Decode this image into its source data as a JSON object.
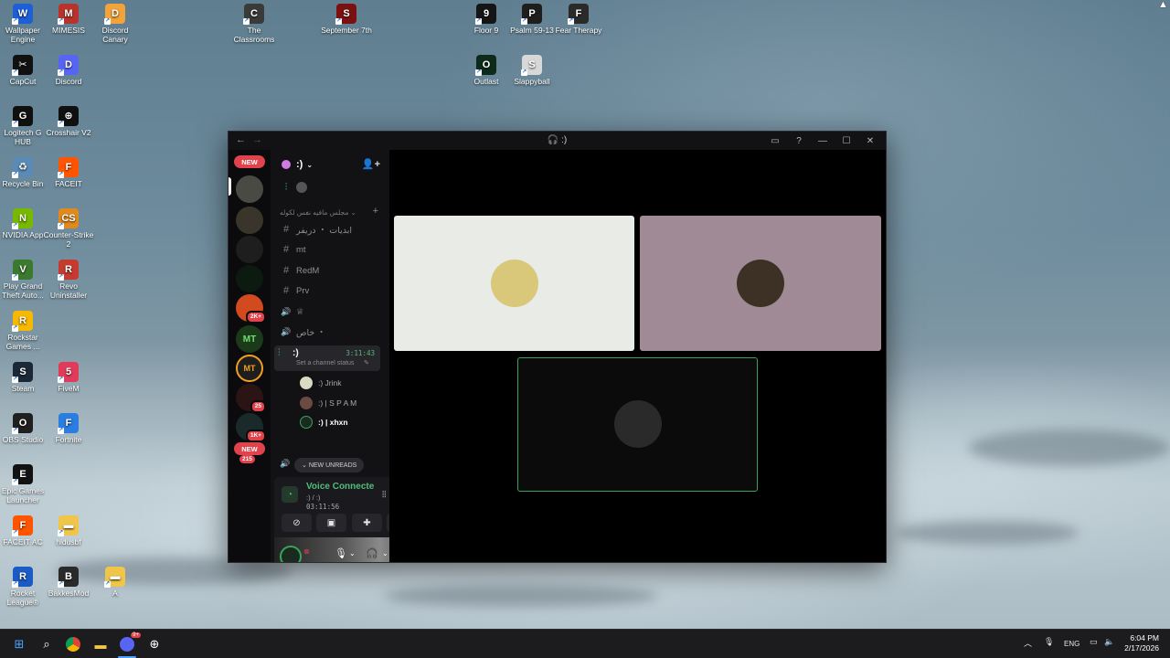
{
  "desktop": {
    "icons": [
      {
        "label": "Wallpaper Engine",
        "color": "#1d5fd6",
        "glyph": "W"
      },
      {
        "label": "MIMESIS",
        "color": "#b8332b",
        "glyph": "M"
      },
      {
        "label": "Discord Canary",
        "color": "#f2a33a",
        "glyph": "D"
      },
      {
        "label": "CapCut",
        "color": "#111111",
        "glyph": "✂"
      },
      {
        "label": "Discord",
        "color": "#5865f2",
        "glyph": "D"
      },
      {
        "label": "Logitech G HUB",
        "color": "#101010",
        "glyph": "G"
      },
      {
        "label": "Crosshair V2",
        "color": "#101010",
        "glyph": "⊕"
      },
      {
        "label": "Recycle Bin",
        "color": "#5a8ab5",
        "glyph": "♻"
      },
      {
        "label": "FACEIT",
        "color": "#ff5500",
        "glyph": "F"
      },
      {
        "label": "NVIDIA App",
        "color": "#76b900",
        "glyph": "N"
      },
      {
        "label": "Counter-Strike 2",
        "color": "#e08a1e",
        "glyph": "CS"
      },
      {
        "label": "Play Grand Theft Auto...",
        "color": "#3b7a2e",
        "glyph": "V"
      },
      {
        "label": "Revo Uninstaller",
        "color": "#c63b2f",
        "glyph": "R"
      },
      {
        "label": "Rockstar Games ...",
        "color": "#f6b800",
        "glyph": "R"
      },
      {
        "label": "Steam",
        "color": "#1b2838",
        "glyph": "S"
      },
      {
        "label": "FiveM",
        "color": "#e13b5a",
        "glyph": "5"
      },
      {
        "label": "OBS Studio",
        "color": "#202020",
        "glyph": "O"
      },
      {
        "label": "Fortnite",
        "color": "#2b7de0",
        "glyph": "F"
      },
      {
        "label": "Epic Games Launcher",
        "color": "#121212",
        "glyph": "E"
      },
      {
        "label": "FACEIT AC",
        "color": "#ff5500",
        "glyph": "F"
      },
      {
        "label": "hidusbf",
        "color": "#f0c64a",
        "glyph": "▬"
      },
      {
        "label": "Rocket League®",
        "color": "#1a5bc4",
        "glyph": "R"
      },
      {
        "label": "BakkesMod",
        "color": "#2a2a2a",
        "glyph": "B"
      },
      {
        "label": "A",
        "color": "#f0c64a",
        "glyph": "▬"
      },
      {
        "label": "The Classrooms",
        "color": "#3a3a3a",
        "glyph": "C"
      },
      {
        "label": "September 7th",
        "color": "#7a1010",
        "glyph": "S"
      },
      {
        "label": "Floor 9",
        "color": "#151515",
        "glyph": "9"
      },
      {
        "label": "Psalm 59-13",
        "color": "#1e1e1e",
        "glyph": "P"
      },
      {
        "label": "Fear Therapy",
        "color": "#2a2a2a",
        "glyph": "F"
      },
      {
        "label": "Outlast",
        "color": "#0e2a1a",
        "glyph": "O"
      },
      {
        "label": "Slappyball",
        "color": "#d8d8d8",
        "glyph": "S"
      }
    ]
  },
  "discord": {
    "window_title": ":)",
    "guild_name": ":)",
    "servers": {
      "new_label": "NEW",
      "badges": [
        "2K+",
        "25",
        "1K+",
        "215"
      ],
      "new_label_2": "NEW"
    },
    "category": "مجلس مافيه نفس لكوله",
    "channels": [
      {
        "sym": "#",
        "name": "ابديات ・ دريفر"
      },
      {
        "sym": "#",
        "name": "mt"
      },
      {
        "sym": "#",
        "name": "RedM"
      },
      {
        "sym": "#",
        "name": "Prv"
      },
      {
        "sym": "🔊",
        "name": "♕"
      },
      {
        "sym": "🔊",
        "name": "خاص ・"
      }
    ],
    "active_voice": {
      "name": ":)",
      "timer": "3:11:43",
      "status": "Set a channel status"
    },
    "voice_users": [
      ":) Jrink",
      ":) | S P A M",
      ":) | xhxn"
    ],
    "new_unreads": "NEW UNREADS",
    "voice_panel": {
      "title": "Voice Connecte",
      "sub": ":) / :)",
      "time": "03:11:56"
    },
    "tiles": [
      {
        "bg": "#e9ebe6",
        "av": "#d9c77a"
      },
      {
        "bg": "#a08a95",
        "av": "#3d3024"
      },
      {
        "bg": "#0b0b0b",
        "av": "#2a2a2a"
      }
    ]
  },
  "taskbar": {
    "lang": "ENG",
    "time": "6:04 PM",
    "date": "2/17/2026",
    "discord_badge": "9+"
  }
}
